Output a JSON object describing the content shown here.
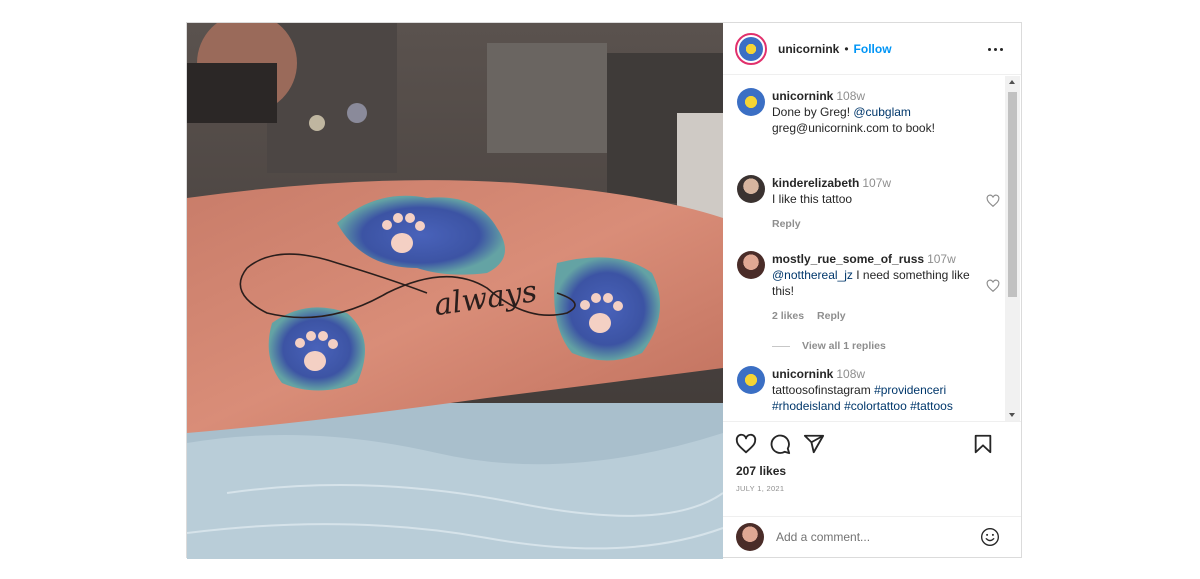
{
  "post": {
    "author": "unicornink",
    "separator": "•",
    "follow_label": "Follow",
    "photo_text": "always",
    "likes": "207 likes",
    "date": "JULY 1, 2021",
    "add_comment_placeholder": "Add a comment..."
  },
  "comments": [
    {
      "user": "unicornink",
      "time": "108w",
      "text_parts": [
        "Done by Greg! ",
        "@cubglam",
        "greg@unicornink.com to book!"
      ]
    },
    {
      "user": "kinderelizabeth",
      "time": "107w",
      "text": "I like this tattoo",
      "reply_label": "Reply"
    },
    {
      "user": "mostly_rue_some_of_russ",
      "time": "107w",
      "mention": "@notthereal_jz",
      "text": " I need something like this!",
      "likes_label": "2 likes",
      "reply_label": "Reply",
      "view_replies": "View all 1 replies"
    },
    {
      "user": "unicornink",
      "time": "108w",
      "text": "tattoosofinstagram ",
      "hashtags": [
        "#providenceri",
        "#rhodeisland",
        "#colortattoo",
        "#tattoos"
      ]
    }
  ],
  "colors": {
    "follow": "#0095f6",
    "mention": "#00376b",
    "muted": "#8e8e8e",
    "story_ring": "#e1306c",
    "tattoo_blue": "#2f4fa8"
  },
  "icons": [
    "more-options-icon",
    "heart-icon",
    "comment-icon",
    "share-icon",
    "bookmark-icon",
    "emoji-icon"
  ]
}
